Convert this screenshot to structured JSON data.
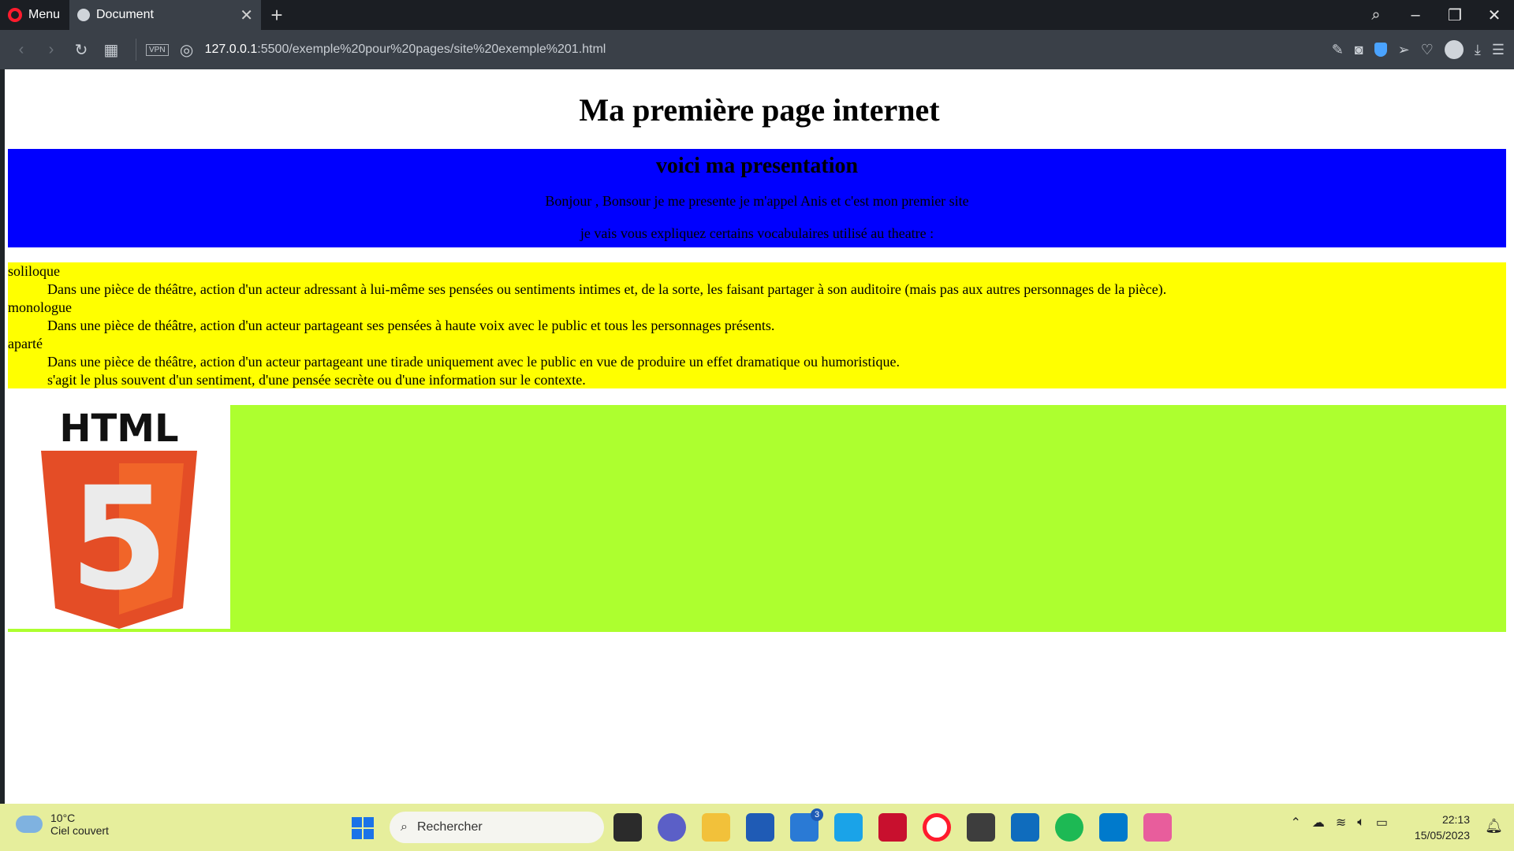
{
  "browser": {
    "menu_label": "Menu",
    "tab_title": "Document",
    "tab_close": "✕",
    "new_tab": "+",
    "url_host": "127.0.0.1",
    "url_rest": ":5500/exemple%20pour%20pages/site%20exemple%201.html",
    "vpn_label": "VPN"
  },
  "page": {
    "title": "Ma première page internet",
    "presentation": {
      "heading": "voici ma presentation",
      "line1": "Bonjour , Bonsour je me presente je m'appel Anis et c'est mon premier site",
      "line2": "je vais vous expliquez certains vocabulaires utilisé au theatre :"
    },
    "definitions": [
      {
        "term": "soliloque",
        "desc": "Dans une pièce de théâtre, action d'un acteur adressant à lui-même ses pensées ou sentiments intimes et, de la sorte, les faisant partager à son auditoire (mais pas aux autres personnages de la pièce)."
      },
      {
        "term": "monologue",
        "desc": "Dans une pièce de théâtre, action d'un acteur partageant ses pensées à haute voix avec le public et tous les personnages présents."
      },
      {
        "term": "aparté",
        "desc": "Dans une pièce de théâtre, action d'un acteur partageant une tirade uniquement avec le public en vue de produire un effet dramatique ou humoristique.",
        "desc2": "s'agit le plus souvent d'un sentiment, d'une pensée secrète ou d'une information sur le contexte."
      }
    ],
    "logo_text": "HTML",
    "logo_number": "5"
  },
  "taskbar": {
    "temperature": "10°C",
    "weather": "Ciel couvert",
    "search_placeholder": "Rechercher",
    "mail_badge": "3",
    "time": "22:13",
    "date": "15/05/2023"
  },
  "colors": {
    "blue_section": "#0000ff",
    "yellow_section": "#ffff00",
    "green_section": "#adff2f",
    "html5_orange": "#e44d26"
  }
}
